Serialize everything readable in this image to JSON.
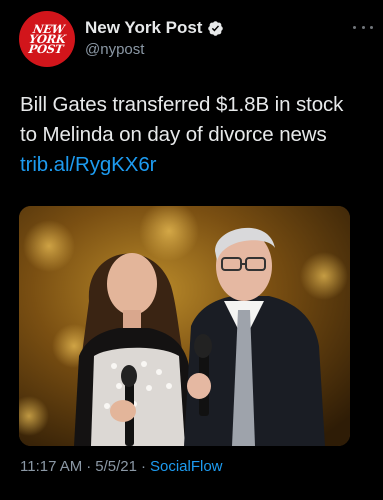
{
  "tweet": {
    "author": {
      "display_name": "New York Post",
      "handle": "@nypost",
      "verified": true,
      "avatar_logo_lines": [
        "NEW",
        "YORK",
        "POST"
      ]
    },
    "text_lines": [
      "Bill Gates transferred $1.8B in stock",
      "to Melinda on day of divorce news"
    ],
    "link": "trib.al/RygKX6r",
    "media": {
      "type": "photo",
      "subjects": [
        "woman-with-microphone",
        "man-with-microphone"
      ]
    },
    "time": "11:17 AM",
    "separator": "·",
    "date": "5/5/21",
    "source": "SocialFlow"
  },
  "colors": {
    "background": "#000000",
    "text": "#e7e9ea",
    "secondary": "#8b98a5",
    "link": "#1d9bf0",
    "avatar": "#d2151b"
  },
  "icons": {
    "more": "more-horizontal-icon",
    "verified": "verified-badge-icon"
  }
}
